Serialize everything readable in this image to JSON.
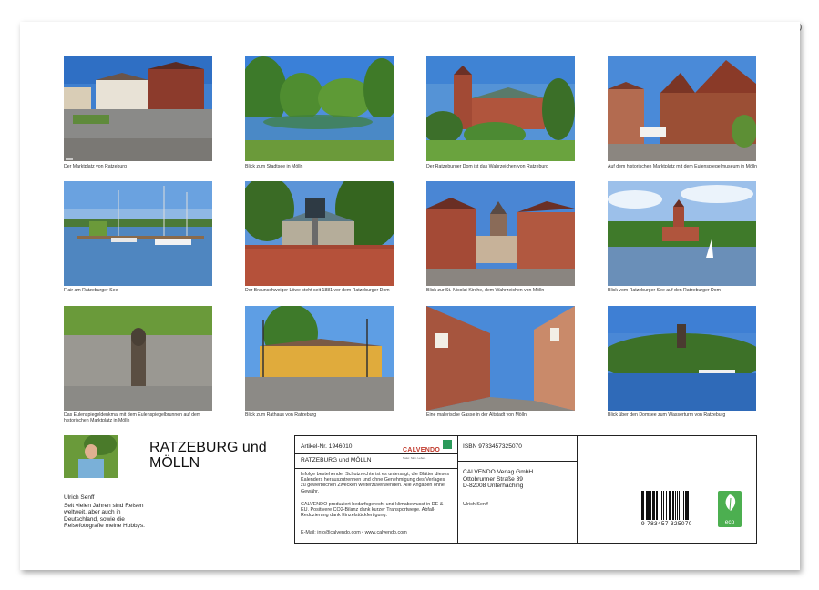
{
  "photos": [
    {
      "caption": "Der Marktplatz von Ratzeburg"
    },
    {
      "caption": "Blick zum Stadtsee in Mölln"
    },
    {
      "caption": "Der Ratzeburger Dom ist das Wahrzeichen von Ratzeburg"
    },
    {
      "caption": "Auf dem historischen Marktplatz mit dem Eulenspiegelmuseum in Mölln"
    },
    {
      "caption": "Flair am Ratzeburger See"
    },
    {
      "caption": "Der Braunschweiger Löwe steht seit 1881 vor dem Ratzeburger Dom"
    },
    {
      "caption": "Blick zur St.-Nicolai-Kirche, dem Wahrzeichen von Mölln"
    },
    {
      "caption": "Blick vom Ratzeburger See auf den Ratzeburger Dom"
    },
    {
      "caption": "Das Eulenspiegeldenkmal mit dem Eulenspiegelbrunnen auf dem historischen Marktplatz in Mölln"
    },
    {
      "caption": "Blick zum Rathaus von Ratzeburg"
    },
    {
      "caption": "Eine malerische Gasse in der Altstadt von Mölln"
    },
    {
      "caption": "Blick über den Domsee zum Wasserturm von Ratzeburg"
    }
  ],
  "title": "RATZEBURG und MÖLLN",
  "author": {
    "name": "Ulrich Senff",
    "bio": "Seit vielen Jahren sind Reisen weltweit, aber auch in Deutschland, sowie die Reisefotografie meine Hobbys."
  },
  "info": {
    "article_no": "Artikel-Nr. 1946010",
    "brand": "CALVENDO",
    "brand_tagline": "Natur. Sinn. Leben.",
    "product_title": "RATZEBURG und MÖLLN",
    "legal": "Infolge bestehender Schutzrechte ist es untersagt, die Blätter dieses Kalenders herauszutrennen und ohne Genehmigung des Verlages zu gewerblichen Zwecken weiterzuverwenden. Alle Angaben ohne Gewähr.",
    "eco_note": "CALVENDO produziert bedarfsgerecht und klimabewusst in DE & EU. Positivere CO2-Bilanz dank kurzer Transportwege. Abfall-Reduzierung dank Einzelstückfertigung.",
    "email": "E-Mail: info@calvendo.com • www.calvendo.com",
    "isbn": "ISBN 9783457325070",
    "publisher_name": "CALVENDO Verlag GmbH",
    "publisher_street": "Ottobrunner Straße 39",
    "publisher_city": "D-82008 Unterhaching",
    "photographer": "Ulrich Senff",
    "barcode_text": "9 783457 325070",
    "eco_label": "eco"
  }
}
